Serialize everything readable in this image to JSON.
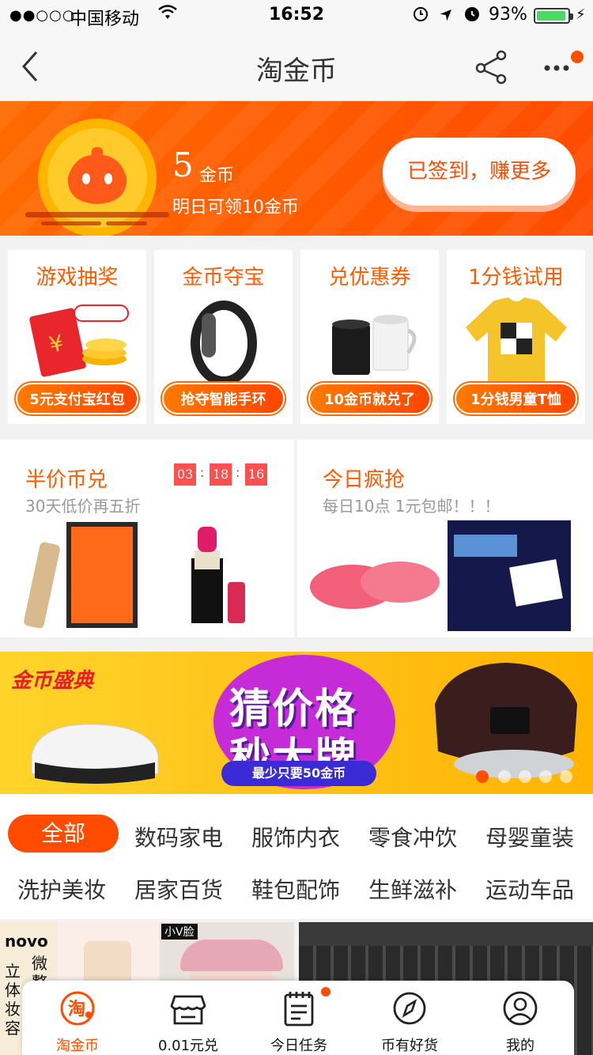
{
  "status_bar": {
    "signal": "●●○○○",
    "carrier": "中国移动",
    "time": "16:52",
    "battery_percent": "93%",
    "battery_level": 0.93
  },
  "nav": {
    "title": "淘金币"
  },
  "coin_header": {
    "count": "5",
    "unit": "金币",
    "next_reward": "明日可领10金币",
    "signin_button": "已签到，赚更多"
  },
  "cards": [
    {
      "title": "游戏抽奖",
      "badge": "5元支付宝红包"
    },
    {
      "title": "金币夺宝",
      "badge": "抢夺智能手环"
    },
    {
      "title": "兑优惠券",
      "badge": "10金币就兑了"
    },
    {
      "title": "1分钱试用",
      "badge": "1分钱男童T恤"
    }
  ],
  "promos": {
    "left": {
      "title": "半价币兑",
      "subtitle": "30天低价再五折",
      "timer": [
        "03",
        "18",
        "16"
      ]
    },
    "right": {
      "title": "今日疯抢",
      "subtitle": "每日10点 1元包邮！！！"
    }
  },
  "banner": {
    "logo": "金币盛典",
    "line1": "猜价格",
    "line2": "秒大牌",
    "sub": "最少只要50金币",
    "active_slide": 1,
    "slide_count": 5
  },
  "categories": [
    {
      "label": "全部",
      "active": true
    },
    {
      "label": "数码家电"
    },
    {
      "label": "服饰内衣"
    },
    {
      "label": "零食冲饮"
    },
    {
      "label": "母婴童装"
    },
    {
      "label": "洗护美妆"
    },
    {
      "label": "居家百货"
    },
    {
      "label": "鞋包配饰"
    },
    {
      "label": "生鲜滋补"
    },
    {
      "label": "运动车品"
    }
  ],
  "products": {
    "left_brand": "novo",
    "left_side_text": "微整",
    "left_vert_text": "立体妆容",
    "left_tag": "小V脸"
  },
  "tabbar": [
    {
      "label": "淘金币",
      "icon": "tao-coin-icon",
      "active": true
    },
    {
      "label": "0.01元兑",
      "icon": "store-icon"
    },
    {
      "label": "今日任务",
      "icon": "task-list-icon",
      "badge": true
    },
    {
      "label": "币有好货",
      "icon": "compass-icon"
    },
    {
      "label": "我的",
      "icon": "user-icon"
    }
  ],
  "colors": {
    "brand_orange": "#ff4c00",
    "coin_yellow": "#ffcb2b",
    "banner_purple": "#c52bd6"
  }
}
